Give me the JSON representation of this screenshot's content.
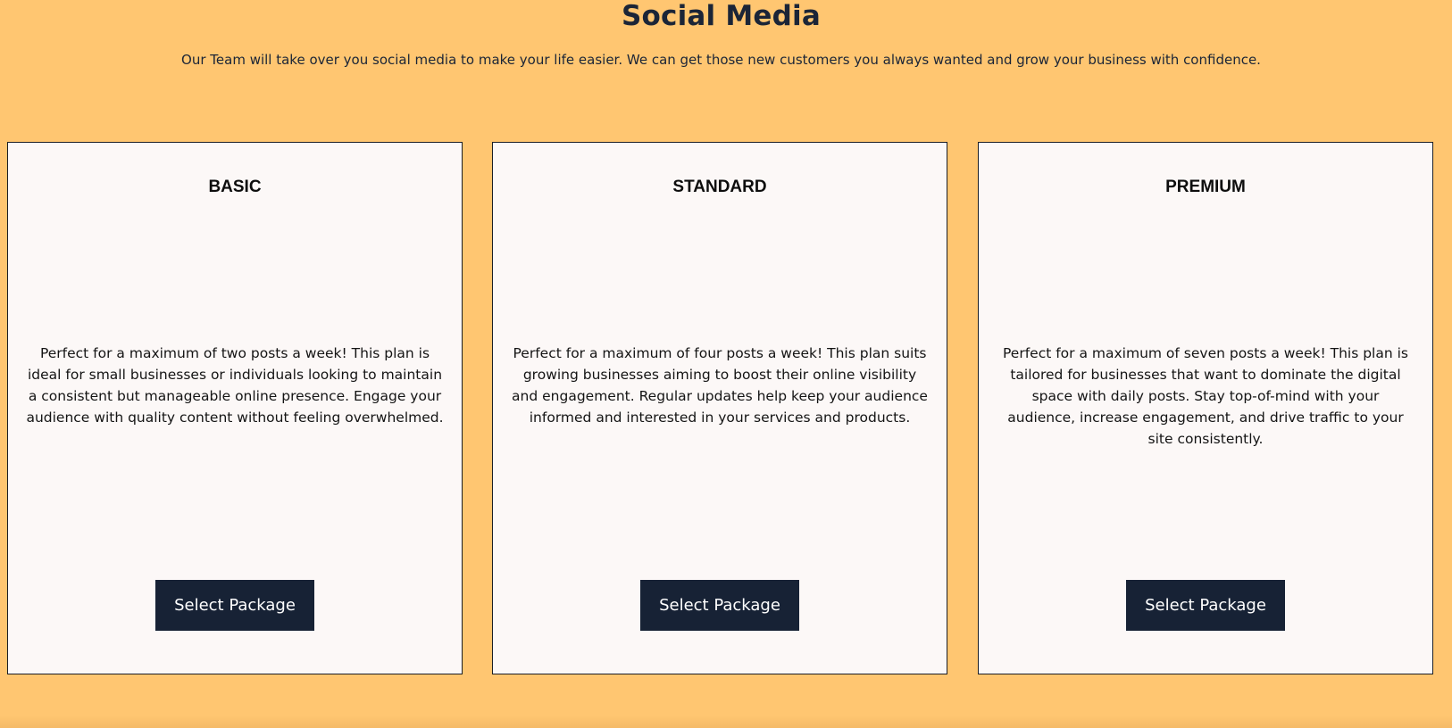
{
  "hero": {
    "title": "Social Media",
    "subtitle": "Our Team will take over you social media to make your life easier. We can get those new customers you always wanted and grow your business with confidence."
  },
  "colors": {
    "background": "#ffc671",
    "card_background": "#fcf8f7",
    "button_background": "#172235",
    "button_text": "#ffffff",
    "title_text": "#1b2537"
  },
  "plans": [
    {
      "name": "BASIC",
      "description": "Perfect for a maximum of two posts a week! This plan is ideal for small businesses or individuals looking to maintain a consistent but manageable online presence. Engage your audience with quality content without feeling overwhelmed.",
      "button_label": "Select Package"
    },
    {
      "name": "STANDARD",
      "description": "Perfect for a maximum of four posts a week! This plan suits growing businesses aiming to boost their online visibility and engagement. Regular updates help keep your audience informed and interested in your services and products.",
      "button_label": "Select Package"
    },
    {
      "name": "PREMIUM",
      "description": "Perfect for a maximum of seven posts a week! This plan is tailored for businesses that want to dominate the digital space with daily posts. Stay top-of-mind with your audience, increase engagement, and drive traffic to your site consistently.",
      "button_label": "Select Package"
    }
  ]
}
